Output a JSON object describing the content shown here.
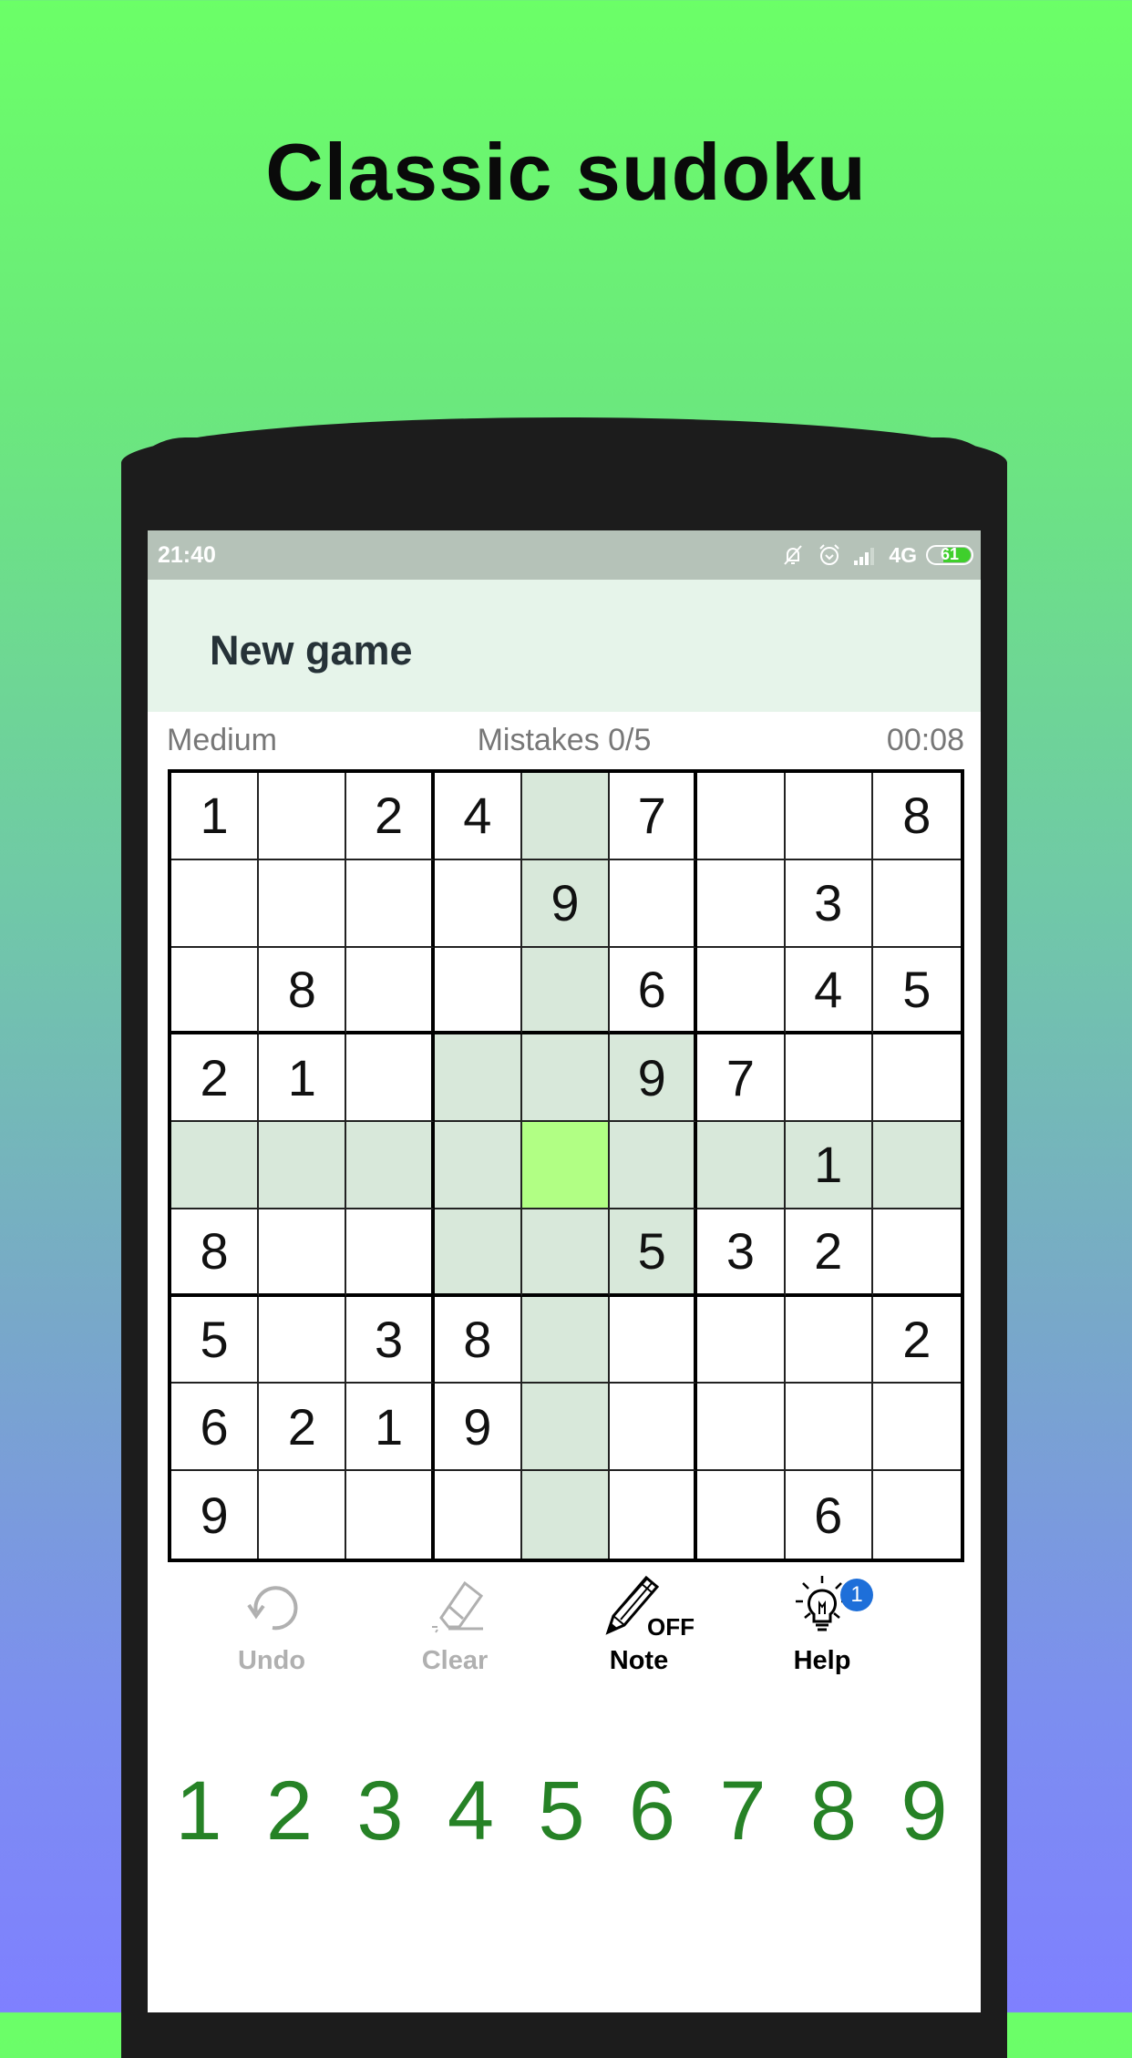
{
  "promo": {
    "title": "Classic sudoku"
  },
  "statusbar": {
    "time": "21:40",
    "icons": [
      "bell-off-icon",
      "alarm-icon",
      "signal-icon"
    ],
    "network": "4G",
    "battery_level": "61"
  },
  "appbar": {
    "title": "New game"
  },
  "info": {
    "difficulty": "Medium",
    "mistakes": "Mistakes 0/5",
    "timer": "00:08"
  },
  "board": {
    "selected": {
      "row": 4,
      "col": 4
    },
    "rows": [
      [
        "1",
        "",
        "2",
        "4",
        "",
        "7",
        "",
        "",
        "8"
      ],
      [
        "",
        "",
        "",
        "",
        "9",
        "",
        "",
        "3",
        ""
      ],
      [
        "",
        "8",
        "",
        "",
        "",
        "6",
        "",
        "4",
        "5"
      ],
      [
        "2",
        "1",
        "",
        "",
        "",
        "9",
        "7",
        "",
        ""
      ],
      [
        "",
        "",
        "",
        "",
        "",
        "",
        "",
        "1",
        ""
      ],
      [
        "8",
        "",
        "",
        "",
        "",
        "5",
        "3",
        "2",
        ""
      ],
      [
        "5",
        "",
        "3",
        "8",
        "",
        "",
        "",
        "",
        "2"
      ],
      [
        "6",
        "2",
        "1",
        "9",
        "",
        "",
        "",
        "",
        ""
      ],
      [
        "9",
        "",
        "",
        "",
        "",
        "",
        "",
        "6",
        ""
      ]
    ]
  },
  "toolbar": {
    "undo": {
      "label": "Undo",
      "icon": "undo-icon",
      "enabled": false
    },
    "clear": {
      "label": "Clear",
      "icon": "eraser-icon",
      "enabled": false
    },
    "note": {
      "label": "Note",
      "icon": "pencil-icon",
      "state": "OFF",
      "enabled": true
    },
    "help": {
      "label": "Help",
      "icon": "lightbulb-icon",
      "badge": "1",
      "enabled": true
    }
  },
  "numpad": {
    "keys": [
      "1",
      "2",
      "3",
      "4",
      "5",
      "6",
      "7",
      "8",
      "9"
    ]
  },
  "colors": {
    "highlight": "#d8e8da",
    "selected": "#b1ff84",
    "numpad": "#268226",
    "appbar": "#e6f4ea",
    "statusbar": "#b5c2b8",
    "badge": "#1e6fd9"
  }
}
